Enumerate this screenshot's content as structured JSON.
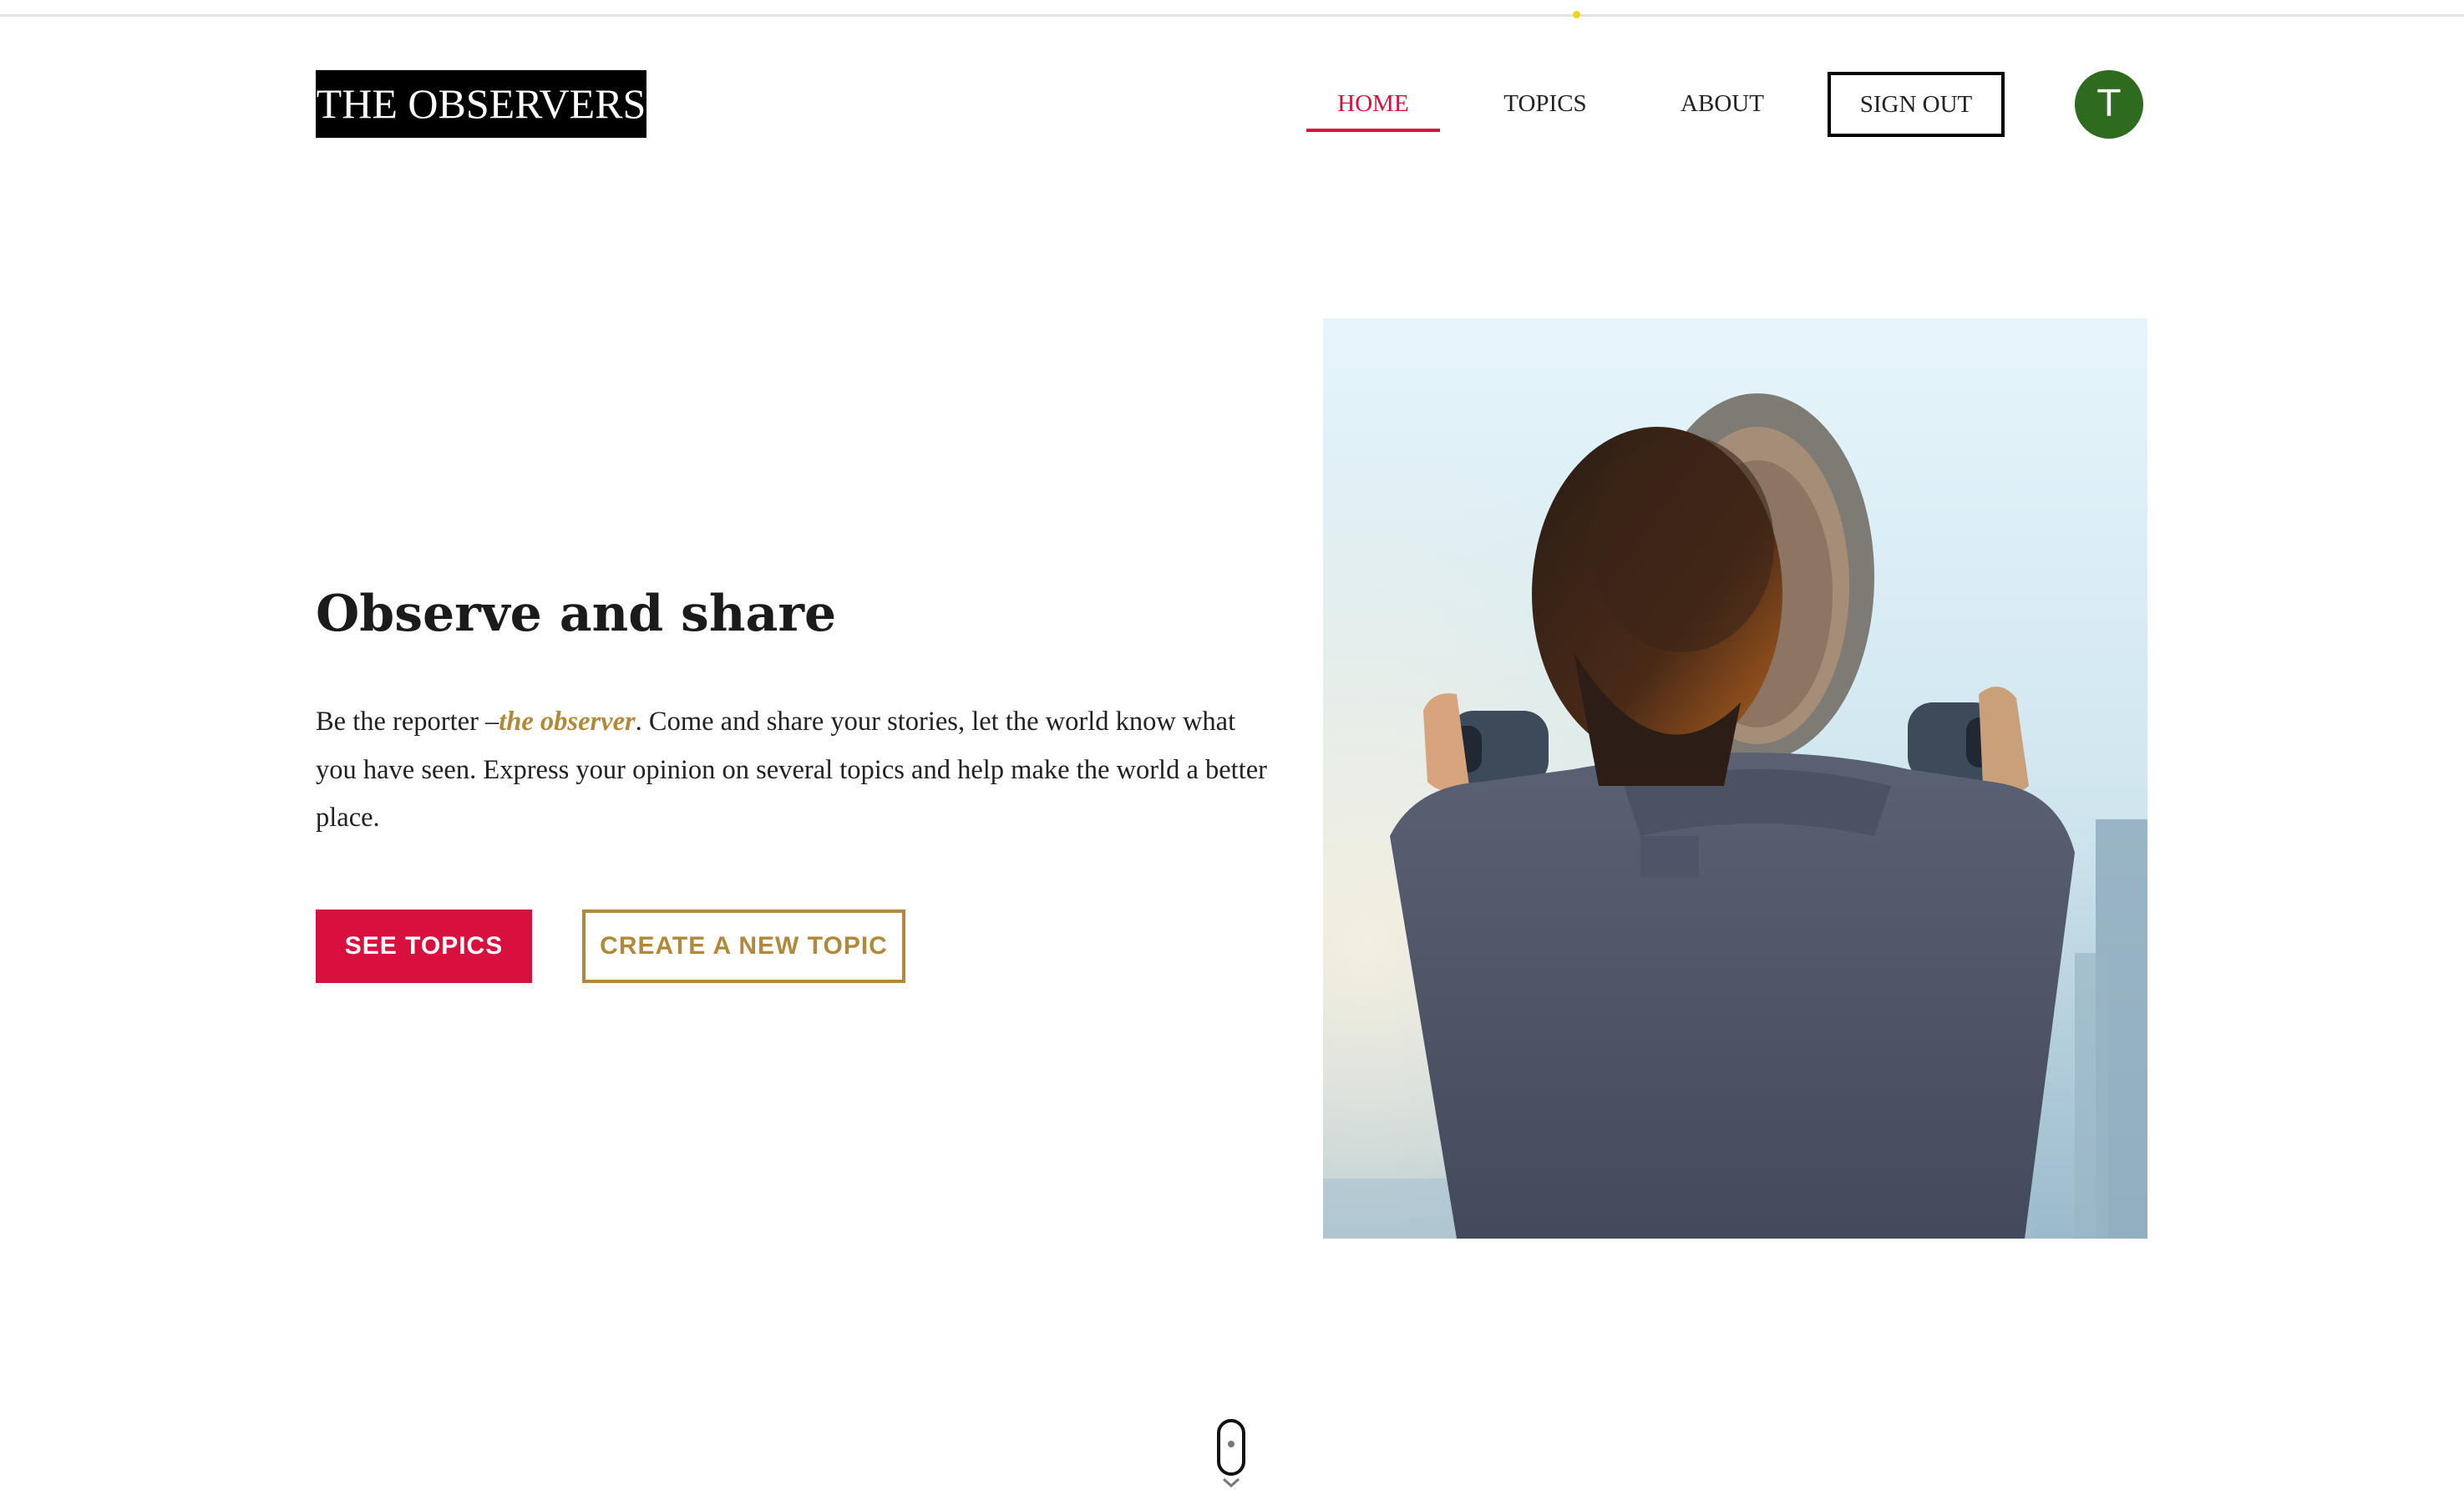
{
  "header": {
    "logo": "THE OBSERVERS",
    "nav": [
      {
        "label": "HOME",
        "active": true
      },
      {
        "label": "TOPICS",
        "active": false
      },
      {
        "label": "ABOUT",
        "active": false
      }
    ],
    "signout_label": "SIGN OUT",
    "avatar_initial": "T"
  },
  "hero": {
    "title": "Observe and share",
    "text_before": "Be the reporter –",
    "text_emphasis": "the observer",
    "text_after": ". Come and share your stories, let the world know what you have seen. Express your opinion on several topics and help make the world a better place.",
    "primary_button": "SEE TOPICS",
    "secondary_button": "CREATE A NEW TOPIC",
    "image_icon": "person-using-binoculars-image"
  },
  "colors": {
    "accent": "#d90f3d",
    "gold": "#b08a3a",
    "avatar": "#2e6b1f",
    "logo_bg": "#000000"
  },
  "scroll_icon": "mouse-scroll-icon"
}
